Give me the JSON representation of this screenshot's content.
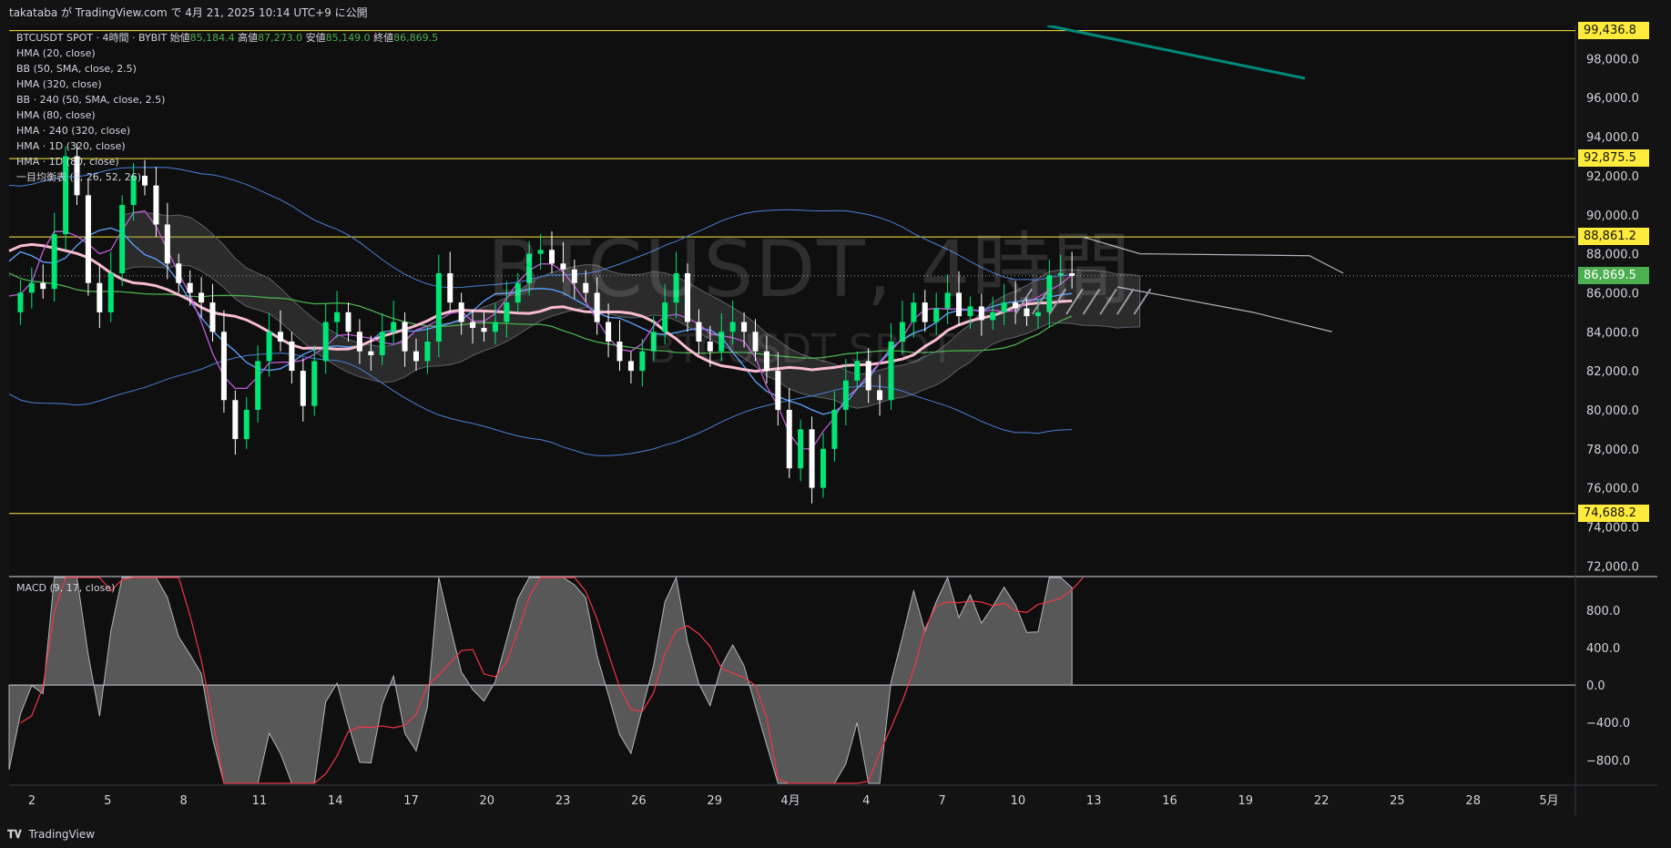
{
  "header": {
    "publish_line": "takataba が TradingView.com で 4月 21, 2025 10:14 UTC+9 に公開"
  },
  "symbol": {
    "line_prefix": "BTCUSDT SPOT · 4時間 · BYBIT",
    "open_label": "始値",
    "open": "85,184.4",
    "high_label": "高値",
    "high": "87,273.0",
    "low_label": "安値",
    "low": "85,149.0",
    "close_label": "終値",
    "close": "86,869.5"
  },
  "watermark": {
    "main": "BTCUSDT, 4時間",
    "sub": "BTCUSDT SPOT"
  },
  "indicators": [
    "HMA (20, close)",
    "BB (50, SMA, close, 2.5)",
    "HMA (320, close)",
    "BB · 240 (50, SMA, close, 2.5)",
    "HMA (80, close)",
    "HMA · 240 (320, close)",
    "HMA · 1D (320, close)",
    "HMA · 1D (80, close)",
    "一目均衡表 (9, 26, 52, 26)"
  ],
  "macd_label": "MACD (9, 17, close)",
  "price_tags": [
    {
      "value": "99,436.8",
      "price": 99436.8,
      "color": "#ffeb3b"
    },
    {
      "value": "92,875.5",
      "price": 92875.5,
      "color": "#ffeb3b"
    },
    {
      "value": "88,861.2",
      "price": 88861.2,
      "color": "#ffeb3b"
    },
    {
      "value": "86,869.5",
      "price": 86869.5,
      "color": "#4caf50"
    },
    {
      "value": "74,688.2",
      "price": 74688.2,
      "color": "#ffeb3b"
    }
  ],
  "footer": {
    "brand": "TradingView"
  },
  "chart_data": {
    "type": "line",
    "title": "BTCUSDT SPOT · 4時間 · BYBIT",
    "y_ticks": [
      "98,000.0",
      "96,000.0",
      "94,000.0",
      "92,000.0",
      "90,000.0",
      "88,000.0",
      "86,000.0",
      "84,000.0",
      "82,000.0",
      "80,000.0",
      "78,000.0",
      "76,000.0",
      "74,000.0",
      "72,000.0"
    ],
    "y_tick_values": [
      98000,
      96000,
      94000,
      92000,
      90000,
      88000,
      86000,
      84000,
      82000,
      80000,
      78000,
      76000,
      74000,
      72000
    ],
    "ylim": [
      71500,
      99700
    ],
    "x_ticks": [
      "2",
      "5",
      "8",
      "11",
      "14",
      "17",
      "20",
      "23",
      "26",
      "29",
      "4月",
      "4",
      "7",
      "10",
      "13",
      "16",
      "19",
      "22",
      "25",
      "28",
      "5月"
    ],
    "horizontal_levels": [
      99436.8,
      92875.5,
      88861.2,
      74688.2
    ],
    "last_price": 86869.5,
    "price_series": {
      "name": "BTCUSDT close",
      "x": [
        0,
        1,
        2,
        3,
        4,
        5,
        6,
        7,
        8,
        9,
        10,
        11,
        12,
        13,
        14,
        15,
        16,
        17,
        18,
        19,
        20,
        21,
        22,
        23,
        24,
        25,
        26,
        27,
        28,
        29,
        30,
        31,
        32,
        33,
        34,
        35,
        36,
        37,
        38,
        39,
        40,
        41,
        42,
        43,
        44,
        45,
        46,
        47,
        48,
        49,
        50,
        51,
        52,
        53,
        54,
        55,
        56,
        57,
        58,
        59,
        60,
        61,
        62,
        63,
        64,
        65,
        66,
        67,
        68,
        69,
        70,
        71,
        72,
        73,
        74,
        75,
        76,
        77,
        78,
        79,
        80,
        81,
        82,
        83,
        84,
        85,
        86,
        87,
        88,
        89,
        90,
        91,
        92,
        93,
        94,
        95,
        96,
        97,
        98,
        99,
        100,
        101,
        102,
        103,
        104,
        105,
        106,
        107,
        108,
        109,
        110,
        111,
        112,
        113,
        114,
        115,
        116,
        117,
        118,
        119,
        120
      ],
      "values": [
        85000,
        86000,
        86500,
        86200,
        89000,
        93000,
        91000,
        86500,
        85000,
        87000,
        90500,
        92000,
        91500,
        89500,
        87500,
        86500,
        86000,
        85500,
        84000,
        80500,
        78500,
        80000,
        82500,
        84000,
        83500,
        82000,
        80200,
        82500,
        84500,
        85000,
        84000,
        83000,
        82800,
        84000,
        84500,
        83000,
        82500,
        83500,
        87000,
        85500,
        84500,
        84200,
        84000,
        84500,
        85500,
        86500,
        88000,
        88200,
        87500,
        87200,
        86500,
        86000,
        84500,
        83500,
        82500,
        82000,
        83000,
        84000,
        85500,
        87000,
        84500,
        83500,
        83000,
        84000,
        84500,
        84000,
        83000,
        82000,
        80000,
        77000,
        79000,
        76000,
        78000,
        80000,
        81500,
        82500,
        81000,
        80500,
        83500,
        84500,
        85500,
        84500,
        85200,
        86000,
        84800,
        85300,
        84600,
        85000,
        85500,
        85200,
        84800,
        85000,
        86900,
        87000,
        86869.5,
        86869.5,
        86869.5,
        86869.5,
        86869.5,
        86869.5,
        86869.5,
        86869.5,
        86869.5,
        86869.5,
        86869.5,
        86869.5,
        86869.5,
        86869.5,
        86869.5,
        86869.5,
        86869.5,
        86869.5,
        86869.5,
        86869.5,
        86869.5,
        86869.5,
        86869.5,
        86869.5,
        86869.5,
        86869.5,
        86869.5
      ]
    },
    "macd": {
      "y_ticks": [
        "800.0",
        "400.0",
        "0.0",
        "−400.0",
        "−800.0"
      ],
      "y_tick_values": [
        800,
        400,
        0,
        -400,
        -800
      ],
      "ylim": [
        -1050,
        1150
      ]
    }
  }
}
